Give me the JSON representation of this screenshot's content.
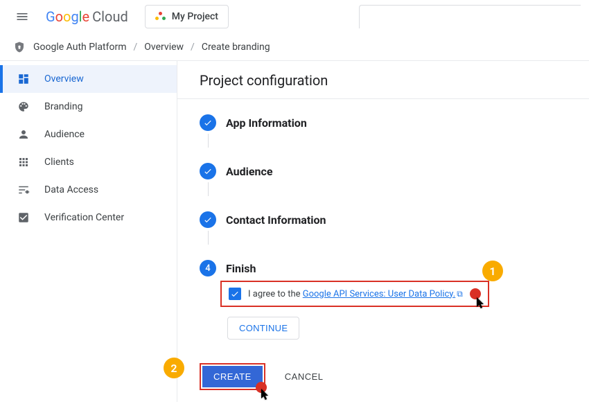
{
  "header": {
    "logo_cloud": "Cloud",
    "project_label": "My Project"
  },
  "breadcrumb": {
    "product": "Google Auth Platform",
    "items": [
      "Overview",
      "Create branding"
    ]
  },
  "sidebar": {
    "items": [
      {
        "label": "Overview"
      },
      {
        "label": "Branding"
      },
      {
        "label": "Audience"
      },
      {
        "label": "Clients"
      },
      {
        "label": "Data Access"
      },
      {
        "label": "Verification Center"
      }
    ]
  },
  "main": {
    "title": "Project configuration",
    "steps": {
      "s1": "App Information",
      "s2": "Audience",
      "s3": "Contact Information",
      "s4": "Finish",
      "s4_number": "4"
    },
    "finish": {
      "agree_prefix": "I agree to the ",
      "agree_link": "Google API Services: User Data Policy."
    },
    "continue_label": "CONTINUE",
    "create_label": "CREATE",
    "cancel_label": "CANCEL"
  },
  "callouts": {
    "one": "1",
    "two": "2"
  }
}
